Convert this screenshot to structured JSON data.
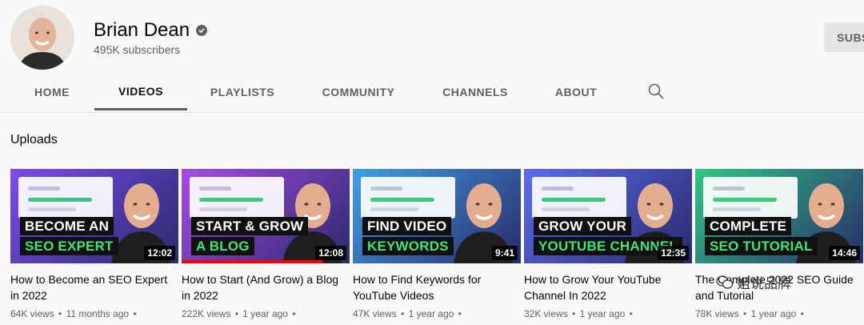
{
  "channel": {
    "name": "Brian Dean",
    "subscribers": "495K subscribers",
    "subscribe_label": "SUBS"
  },
  "tabs": [
    {
      "label": "HOME"
    },
    {
      "label": "VIDEOS",
      "active": true
    },
    {
      "label": "PLAYLISTS"
    },
    {
      "label": "COMMUNITY"
    },
    {
      "label": "CHANNELS"
    },
    {
      "label": "ABOUT"
    }
  ],
  "section": {
    "title": "Uploads"
  },
  "videos": [
    {
      "thumb_line1": "BECOME AN",
      "thumb_line2": "SEO EXPERT",
      "duration": "12:02",
      "title": "How to Become an SEO Expert in 2022",
      "views": "64K views",
      "age": "11 months ago",
      "thumb_color": "#7a4df0",
      "progress": 0
    },
    {
      "thumb_line1": "START & GROW",
      "thumb_line2": "A BLOG",
      "duration": "12:08",
      "title": "How to Start (And Grow) a Blog in 2022",
      "views": "222K views",
      "age": "1 year ago",
      "thumb_color": "#a64ae8",
      "progress": 0.84
    },
    {
      "thumb_line1": "FIND VIDEO",
      "thumb_line2": "KEYWORDS",
      "duration": "9:41",
      "title": "How to Find Keywords for YouTube Videos",
      "views": "47K views",
      "age": "1 year ago",
      "thumb_color": "#3fa0e6",
      "progress": 0
    },
    {
      "thumb_line1": "GROW YOUR",
      "thumb_line2": "YOUTUBE CHANNEL",
      "duration": "12:35",
      "title": "How to Grow Your YouTube Channel In 2022",
      "views": "32K views",
      "age": "1 year ago",
      "thumb_color": "#5b6cf0",
      "progress": 0
    },
    {
      "thumb_line1": "COMPLETE",
      "thumb_line2": "SEO TUTORIAL",
      "duration": "14:46",
      "title": "The Complete 2022 SEO Guide and Tutorial",
      "views": "78K views",
      "age": "1 year ago",
      "thumb_color": "#2fc787",
      "progress": 0
    }
  ],
  "watermark": {
    "text": "姐说品牌"
  }
}
